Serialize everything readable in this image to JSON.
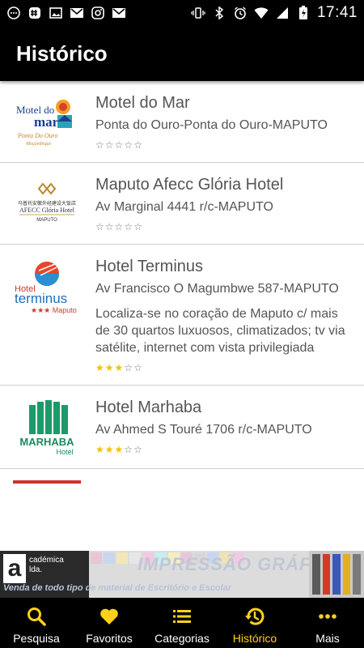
{
  "status_bar": {
    "time": "17:41",
    "left_icons": [
      "whatsapp-icon",
      "hashtag-icon",
      "image-icon",
      "gmail-icon",
      "instagram-icon",
      "gmail-icon"
    ],
    "right_icons": [
      "vibrate-icon",
      "bluetooth-icon",
      "alarm-icon",
      "wifi-icon",
      "signal-icon",
      "battery-charging-icon"
    ]
  },
  "app_bar": {
    "title": "Histórico"
  },
  "hotels": [
    {
      "name": "Motel do Mar",
      "address": "Ponta do Ouro-Ponta do Ouro-MAPUTO",
      "description": "",
      "rating": 0,
      "logo": {
        "line1": "Motel do",
        "line2": "mar",
        "line3": "Ponta Do Ouro",
        "line4": "Moçambique"
      }
    },
    {
      "name": "Maputo Afecc Glória Hotel",
      "address": "Av Marginal 4441 r/c-MAPUTO",
      "description": "",
      "rating": 0,
      "logo": {
        "line1": "马普托安徽外经建设大饭店",
        "line2": "AFECC Glória Hotel",
        "line3": "MAPUTO"
      }
    },
    {
      "name": "Hotel Terminus",
      "address": "Av Francisco O Magumbwe 587-MAPUTO",
      "description": "Localiza-se no coração de Maputo c/ mais de 30 quartos luxuosos, climatizados; tv via satélite, internet com vista privilegiada",
      "rating": 3,
      "logo": {
        "line1": "Hotel",
        "line2": "terminus",
        "line3": "★★★ Maputo"
      }
    },
    {
      "name": "Hotel Marhaba",
      "address": "Av Ahmed S Touré 1706 r/c-MAPUTO",
      "description": "",
      "rating": 3,
      "logo": {
        "line1": "MARHABA",
        "line2": "Hotel"
      }
    }
  ],
  "ad": {
    "brand_letter": "a",
    "brand_small": "cadémica\nlda.",
    "title": "IMPRESSÃO GRÁFICA",
    "subtitle": "Venda de todo tipo de material de Escritório e Escolar"
  },
  "bottom_nav": {
    "items": [
      {
        "label": "Pesquisa",
        "icon": "search-icon"
      },
      {
        "label": "Favoritos",
        "icon": "heart-icon"
      },
      {
        "label": "Categorias",
        "icon": "list-icon"
      },
      {
        "label": "Histórico",
        "icon": "history-icon"
      },
      {
        "label": "Mais",
        "icon": "more-icon"
      }
    ],
    "active_index": 3
  },
  "colors": {
    "accent": "#ffd21a",
    "bar_background": "#000000",
    "star_on": "#f2c200",
    "text": "#555555"
  }
}
